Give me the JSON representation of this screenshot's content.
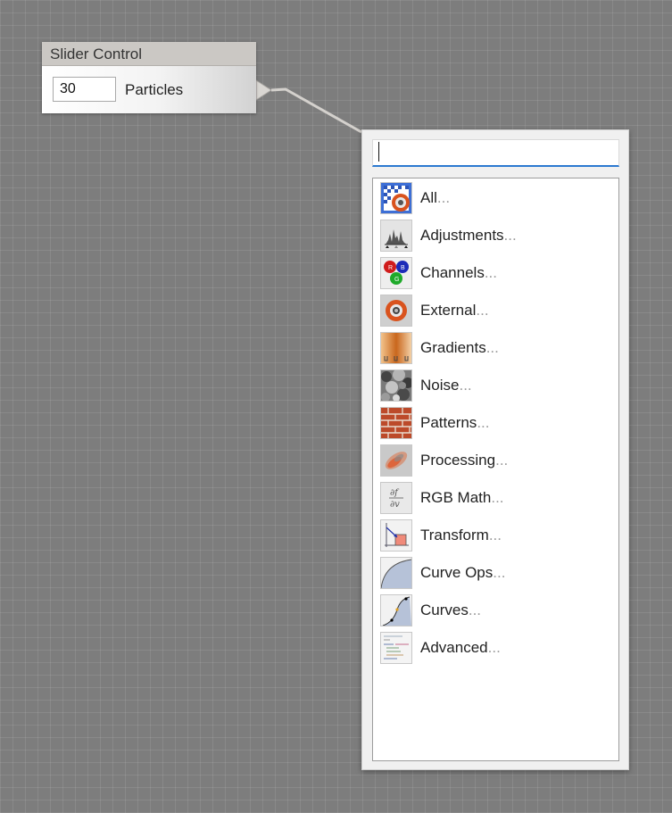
{
  "slider_node": {
    "title": "Slider Control",
    "value": "30",
    "label": "Particles"
  },
  "popup": {
    "search": {
      "value": "",
      "placeholder": ""
    },
    "ellipsis": "...",
    "items": [
      {
        "label": "All",
        "icon": "all-filters-icon"
      },
      {
        "label": "Adjustments",
        "icon": "histogram-icon"
      },
      {
        "label": "Channels",
        "icon": "rgb-channels-icon"
      },
      {
        "label": "External",
        "icon": "external-filter-icon"
      },
      {
        "label": "Gradients",
        "icon": "gradient-icon"
      },
      {
        "label": "Noise",
        "icon": "noise-icon"
      },
      {
        "label": "Patterns",
        "icon": "brick-pattern-icon"
      },
      {
        "label": "Processing",
        "icon": "motion-blur-icon"
      },
      {
        "label": "RGB Math",
        "icon": "partial-derivative-icon"
      },
      {
        "label": "Transform",
        "icon": "transform-icon"
      },
      {
        "label": "Curve Ops",
        "icon": "curve-ops-icon"
      },
      {
        "label": "Curves",
        "icon": "curves-icon"
      },
      {
        "label": "Advanced",
        "icon": "code-icon"
      }
    ]
  },
  "colors": {
    "canvas": "#7d7d7d",
    "search_focus": "#2b79d0",
    "ellipsis": "#9a9a9a"
  }
}
